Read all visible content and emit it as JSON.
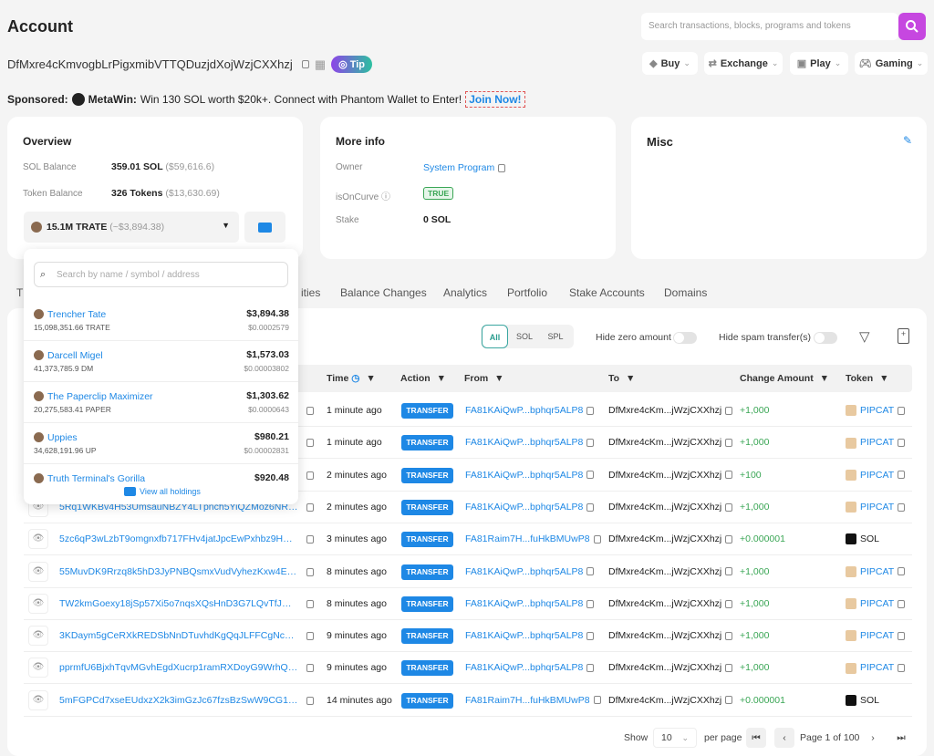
{
  "header": {
    "title": "Account",
    "search_placeholder": "Search transactions, blocks, programs and tokens",
    "address": "DfMxre4cKmvogbLrPigxmibVTTQDuzjdXojWzjCXXhzj",
    "tip_label": "Tip",
    "nav": [
      {
        "label": "Buy",
        "icon": "buy-icon"
      },
      {
        "label": "Exchange",
        "icon": "exchange-icon"
      },
      {
        "label": "Play",
        "icon": "play-icon"
      },
      {
        "label": "Gaming",
        "icon": "gamepad-icon"
      }
    ]
  },
  "sponsored": {
    "label": "Sponsored:",
    "brand": "MetaWin:",
    "text": "Win 130 SOL worth $20k+. Connect with Phantom Wallet to Enter!",
    "cta": "Join Now!"
  },
  "overview": {
    "title": "Overview",
    "sol_label": "SOL Balance",
    "sol_value": "359.01 SOL",
    "sol_usd": "($59,616.6)",
    "token_label": "Token Balance",
    "token_value": "326 Tokens",
    "token_usd": "($13,630.69)",
    "selected_token": "15.1M TRATE",
    "selected_usd": "(~$3,894.38)"
  },
  "more_info": {
    "title": "More info",
    "owner_label": "Owner",
    "owner_value": "System Program",
    "curve_label": "isOnCurve",
    "curve_value": "TRUE",
    "stake_label": "Stake",
    "stake_value": "0 SOL"
  },
  "misc": {
    "title": "Misc"
  },
  "tabs": [
    "T",
    "ities",
    "Balance Changes",
    "Analytics",
    "Portfolio",
    "Stake Accounts",
    "Domains"
  ],
  "filters": {
    "segments": [
      "All",
      "SOL",
      "SPL"
    ],
    "active": "All",
    "hide_zero": "Hide zero amount",
    "hide_spam": "Hide spam transfer(s)",
    "hide_zero_on": false,
    "hide_spam_on": false
  },
  "columns": [
    "Time",
    "Action",
    "From",
    "To",
    "Change Amount",
    "Token"
  ],
  "rows": [
    {
      "sig": "",
      "time": "1 minute ago",
      "action": "TRANSFER",
      "from": "FA81KAiQwP...bphqr5ALP8",
      "to": "DfMxre4cKm...jWzjCXXhzj",
      "amount": "+1,000",
      "token": "PIPCAT"
    },
    {
      "sig": "",
      "time": "1 minute ago",
      "action": "TRANSFER",
      "from": "FA81KAiQwP...bphqr5ALP8",
      "to": "DfMxre4cKm...jWzjCXXhzj",
      "amount": "+1,000",
      "token": "PIPCAT"
    },
    {
      "sig": "",
      "time": "2 minutes ago",
      "action": "TRANSFER",
      "from": "FA81KAiQwP...bphqr5ALP8",
      "to": "DfMxre4cKm...jWzjCXXhzj",
      "amount": "+100",
      "token": "PIPCAT"
    },
    {
      "sig": "5Rq1WKBv4H53UmsauNBZY4LTpnch5YiQZMoz6NRsVkH...",
      "time": "2 minutes ago",
      "action": "TRANSFER",
      "from": "FA81KAiQwP...bphqr5ALP8",
      "to": "DfMxre4cKm...jWzjCXXhzj",
      "amount": "+1,000",
      "token": "PIPCAT"
    },
    {
      "sig": "5zc6qP3wLzbT9omgnxfb717FHv4jatJpcEwPxhbz9HTTK...",
      "time": "3 minutes ago",
      "action": "TRANSFER",
      "from": "FA81Raim7H...fuHkBMUwP8",
      "to": "DfMxre4cKm...jWzjCXXhzj",
      "amount": "+0.000001",
      "token": "SOL"
    },
    {
      "sig": "55MuvDK9Rrzq8k5hD3JyPNBQsmxVudVyhezKxw4EyK3s...",
      "time": "8 minutes ago",
      "action": "TRANSFER",
      "from": "FA81KAiQwP...bphqr5ALP8",
      "to": "DfMxre4cKm...jWzjCXXhzj",
      "amount": "+1,000",
      "token": "PIPCAT"
    },
    {
      "sig": "TW2kmGoexy18jSp57Xi5o7nqsXQsHnD3G7LQvTfJDzSUz...",
      "time": "8 minutes ago",
      "action": "TRANSFER",
      "from": "FA81KAiQwP...bphqr5ALP8",
      "to": "DfMxre4cKm...jWzjCXXhzj",
      "amount": "+1,000",
      "token": "PIPCAT"
    },
    {
      "sig": "3KDaym5gCeRXkREDSbNnDTuvhdKgQqJLFFCgNcMb9jBj...",
      "time": "9 minutes ago",
      "action": "TRANSFER",
      "from": "FA81KAiQwP...bphqr5ALP8",
      "to": "DfMxre4cKm...jWzjCXXhzj",
      "amount": "+1,000",
      "token": "PIPCAT"
    },
    {
      "sig": "pprmfU6BjxhTqvMGvhEgdXucrp1ramRXDoyG9WrhQEqFs...",
      "time": "9 minutes ago",
      "action": "TRANSFER",
      "from": "FA81KAiQwP...bphqr5ALP8",
      "to": "DfMxre4cKm...jWzjCXXhzj",
      "amount": "+1,000",
      "token": "PIPCAT"
    },
    {
      "sig": "5mFGPCd7xseEUdxzX2k3imGzJc67fzsBzSwW9CG1HHyy...",
      "time": "14 minutes ago",
      "action": "TRANSFER",
      "from": "FA81Raim7H...fuHkBMUwP8",
      "to": "DfMxre4cKm...jWzjCXXhzj",
      "amount": "+0.000001",
      "token": "SOL"
    }
  ],
  "dropdown": {
    "search_placeholder": "Search by name / symbol / address",
    "view_all": "View all holdings",
    "items": [
      {
        "name": "Trencher Tate",
        "amount": "15,098,351.66 TRATE",
        "usd": "$3,894.38",
        "price": "$0.0002579"
      },
      {
        "name": "Darcell Migel",
        "amount": "41,373,785.9 DM",
        "usd": "$1,573.03",
        "price": "$0.00003802"
      },
      {
        "name": "The Paperclip Maximizer",
        "amount": "20,275,583.41 PAPER",
        "usd": "$1,303.62",
        "price": "$0.0000643"
      },
      {
        "name": "Uppies",
        "amount": "34,628,191.96 UP",
        "usd": "$980.21",
        "price": "$0.00002831"
      },
      {
        "name": "Truth Terminal's Gorilla",
        "amount": "",
        "usd": "$920.48",
        "price": ""
      }
    ]
  },
  "pagination": {
    "show": "Show",
    "per_page_value": "10",
    "per_page": "per page",
    "page_text": "Page 1 of 100"
  },
  "colors": {
    "accent": "#1e88e5",
    "search_button": "#c647e0",
    "positive": "#3aa655",
    "true_badge": "#3aa655"
  }
}
